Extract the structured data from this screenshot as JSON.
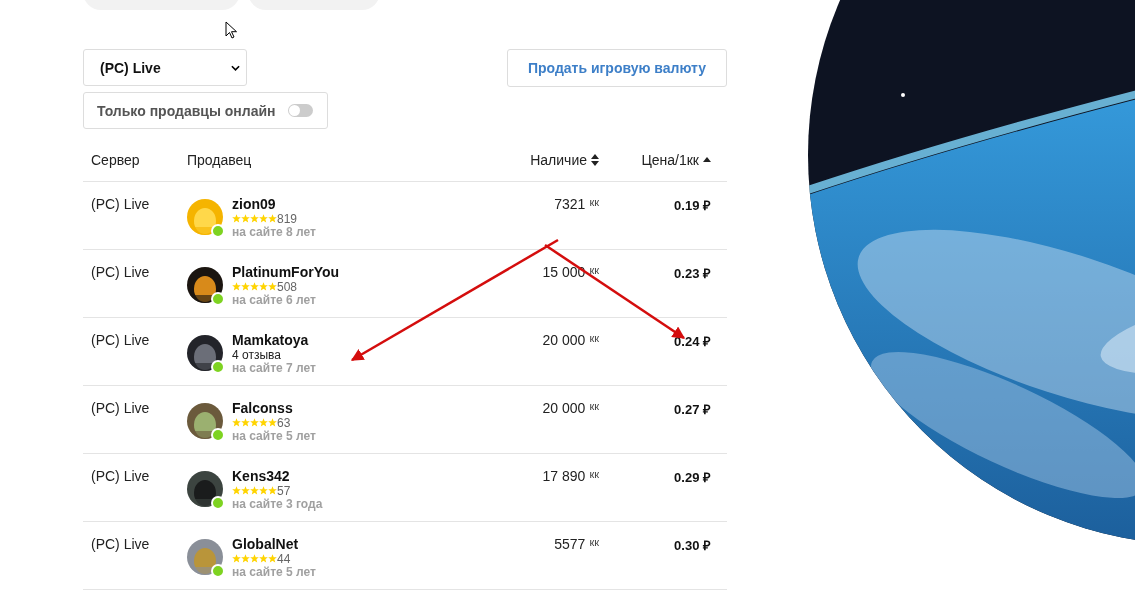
{
  "server_select": {
    "value": "(PC) Live"
  },
  "sell_button": {
    "label": "Продать игровую валюту"
  },
  "online_filter": {
    "label": "Только продавцы онлайн",
    "on": false
  },
  "table": {
    "columns": [
      {
        "label": "Сервер",
        "kind": "plain"
      },
      {
        "label": "Продавец",
        "kind": "plain"
      },
      {
        "label": "Наличие",
        "kind": "sortable"
      },
      {
        "label": "Цена/1кк",
        "kind": "sorted_asc"
      }
    ],
    "rows": [
      {
        "server": "(PC) Live",
        "seller": "zion09",
        "kind": "count",
        "stars": 5,
        "reviews": "819",
        "tenure": "на сайте 8 лет",
        "online": true,
        "quantity": "7321",
        "unit": "кк",
        "price": "0.19 ₽"
      },
      {
        "server": "(PC) Live",
        "seller": "PlatinumForYou",
        "kind": "count",
        "stars": 5,
        "reviews": "508",
        "tenure": "на сайте 6 лет",
        "online": true,
        "quantity": "15 000",
        "unit": "кк",
        "price": "0.23 ₽"
      },
      {
        "server": "(PC) Live",
        "seller": "Mamkatoya",
        "kind": "text",
        "reviews": "4 отзыва",
        "tenure": "на сайте 7 лет",
        "online": true,
        "quantity": "20 000",
        "unit": "кк",
        "price": "0.24 ₽"
      },
      {
        "server": "(PC) Live",
        "seller": "Falconss",
        "kind": "count",
        "stars": 5,
        "reviews": "63",
        "tenure": "на сайте 5 лет",
        "online": true,
        "quantity": "20 000",
        "unit": "кк",
        "price": "0.27 ₽"
      },
      {
        "server": "(PC) Live",
        "seller": "Kens342",
        "kind": "count",
        "stars": 5,
        "reviews": "57",
        "tenure": "на сайте 3 года",
        "online": true,
        "quantity": "17 890",
        "unit": "кк",
        "price": "0.29 ₽"
      },
      {
        "server": "(PC) Live",
        "seller": "GlobalNet",
        "kind": "count",
        "stars": 5,
        "reviews": "44",
        "tenure": "на сайте 5 лет",
        "online": true,
        "quantity": "5577",
        "unit": "кк",
        "price": "0.30 ₽"
      }
    ]
  }
}
